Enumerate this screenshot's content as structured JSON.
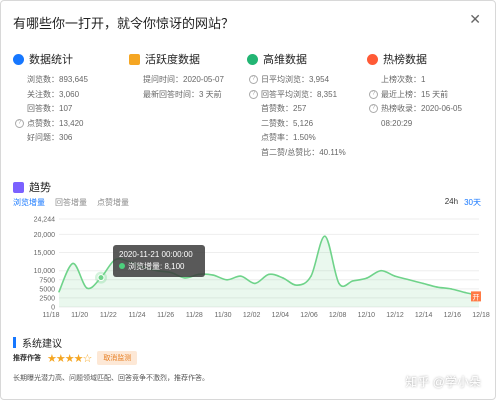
{
  "dialog": {
    "title": "有哪些你一打开，就令你惊讶的网站？",
    "close_label": "✕"
  },
  "stats": {
    "data": {
      "title": "数据统计",
      "rows": [
        {
          "label": "浏览数：",
          "value": "893,645"
        },
        {
          "label": "关注数：",
          "value": "3,060"
        },
        {
          "label": "回答数：",
          "value": "107"
        },
        {
          "label": "点赞数：",
          "value": "13,420"
        },
        {
          "label": "好问题：",
          "value": "306"
        }
      ]
    },
    "activity": {
      "title": "活跃度数据",
      "rows": [
        {
          "label": "提问时间：",
          "value": "2020-05-07"
        },
        {
          "label": "最新回答时间：",
          "value": "3 天前"
        }
      ]
    },
    "advanced": {
      "title": "高维数据",
      "rows": [
        {
          "label": "日平均浏览：",
          "value": "3,954"
        },
        {
          "label": "回答平均浏览：",
          "value": "8,351"
        },
        {
          "label": "首赞数：",
          "value": "257"
        },
        {
          "label": "二赞数：",
          "value": "5,126"
        },
        {
          "label": "点赞率：",
          "value": "1.50%"
        },
        {
          "label": "首二赞/总赞比：",
          "value": "40.11%"
        }
      ]
    },
    "hot": {
      "title": "热榜数据",
      "rows": [
        {
          "label": "上榜次数：",
          "value": "1"
        },
        {
          "label": "最近上榜：",
          "value": "15 天前"
        },
        {
          "label": "热榜收录：",
          "value": "2020-06-05"
        },
        {
          "label": "",
          "value": "08:20:29"
        }
      ]
    }
  },
  "trend": {
    "title": "趋势",
    "tabs": [
      "浏览增量",
      "回答增量",
      "点赞增量"
    ],
    "ranges": [
      "24h",
      "30天"
    ],
    "tooltip": {
      "date": "2020-11-21 00:00:00",
      "label": "浏览增量: 8,100"
    },
    "end_marker": "开"
  },
  "chart_data": {
    "type": "area",
    "ylim": [
      0,
      24244
    ],
    "y_ticks": [
      0,
      2500,
      5000,
      7500,
      10000,
      15000,
      20000,
      24244
    ],
    "y_tick_labels": [
      "0",
      "2500",
      "5000",
      "7500",
      "10,000",
      "15,000",
      "20,000",
      "24,244"
    ],
    "x_tick_labels": [
      "11/18",
      "11/20",
      "11/22",
      "11/24",
      "11/26",
      "11/28",
      "11/30",
      "12/02",
      "12/04",
      "12/06",
      "12/08",
      "12/10",
      "12/12",
      "12/14",
      "12/16",
      "12/18"
    ],
    "series": [
      {
        "values": [
          4200,
          12000,
          5200,
          8100,
          13000,
          12500,
          11000,
          10000,
          9500,
          8000,
          9000,
          8800,
          7500,
          8500,
          6500,
          9000,
          8000,
          6000,
          8500,
          19500,
          6500,
          7200,
          8000,
          10000,
          8500,
          7500,
          6500,
          5500,
          5000,
          4000,
          3200
        ]
      }
    ],
    "color": "#6fd38a"
  },
  "suggestions": {
    "title": "系统建议",
    "rec_label": "推荐作答",
    "stars": "★★★★☆",
    "cancel_label": "取消监测",
    "desc": "长期曝光潜力高、问题领域匹配、回答竞争不激烈，推荐作答。"
  },
  "watermark": "知乎 @学小朵"
}
